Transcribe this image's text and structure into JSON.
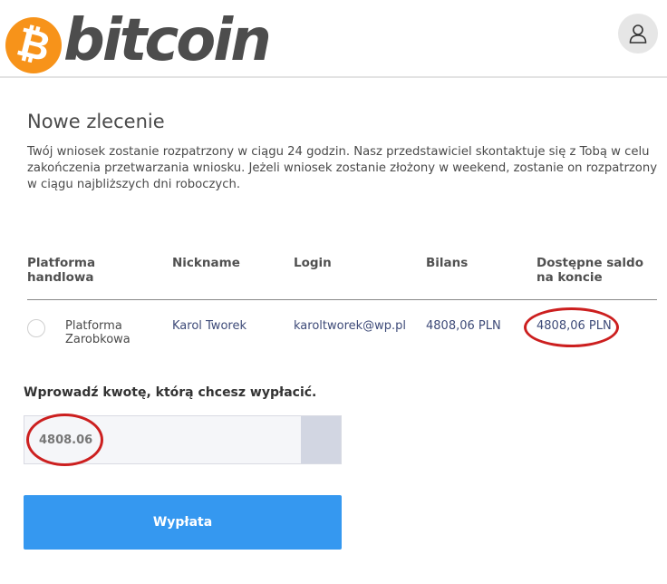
{
  "header": {
    "logo_symbol": "₿",
    "logo_text": "bitcoin",
    "brand_color": "#f7931a",
    "avatar_icon": "user-icon"
  },
  "page": {
    "title": "Nowe zlecenie",
    "intro": "Twój wniosek zostanie rozpatrzony w ciągu 24 godzin. Nasz przedstawiciel skontaktuje się z Tobą w celu zakończenia przetwarzania wniosku. Jeżeli wniosek zostanie złożony w weekend, zostanie on rozpatrzony w ciągu najbliższych dni roboczych."
  },
  "table": {
    "headers": [
      "Platforma handlowa",
      "Nickname",
      "Login",
      "Bilans",
      "Dostępne saldo na koncie"
    ],
    "rows": [
      {
        "platform": "Platforma Zarobkowa",
        "nickname": "Karol Tworek",
        "login": "karoltworek@wp.pl",
        "balance": "4808,06 PLN",
        "available": "4808,06 PLN",
        "selected": false
      }
    ]
  },
  "withdraw": {
    "label": "Wprowadź kwotę, którą chcesz wypłacić.",
    "value": "4808.06",
    "button_label": "Wypłata",
    "button_color": "#3598f0"
  },
  "annotations": {
    "marker_color": "#cc1f1f"
  }
}
